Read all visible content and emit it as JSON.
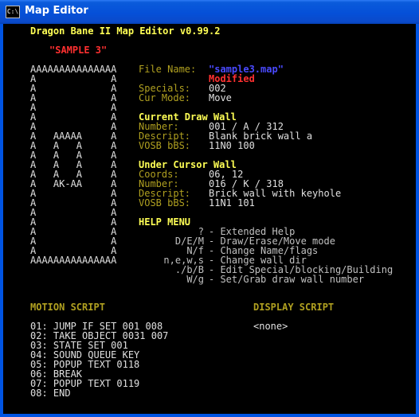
{
  "window": {
    "title": "Map Editor",
    "icon": "C:\\"
  },
  "header": {
    "app_title": "Dragon Bane II Map Editor v0.99.2",
    "map_title": "\"SAMPLE 3\""
  },
  "map_grid": [
    "AAAAAAAAAAAAAAA",
    "A             A",
    "A             A",
    "A             A",
    "A             A",
    "A             A",
    "A             A",
    "A   AAAAA     A",
    "A   A   A     A",
    "A   A   A     A",
    "A   A   A     A",
    "A   A   A     A",
    "A   AK-AA     A",
    "A             A",
    "A             A",
    "A             A",
    "A             A",
    "A             A",
    "A             A",
    "A             A",
    "AAAAAAAAAAAAAAA"
  ],
  "file_info": {
    "file_name_label": "File Name:",
    "file_name": "\"sample3.map\"",
    "modified": "Modified",
    "specials_label": "Specials:",
    "specials": "002",
    "cur_mode_label": "Cur Mode:",
    "cur_mode": "Move"
  },
  "current_draw_wall": {
    "heading": "Current Draw Wall",
    "number_label": "Number:",
    "number": "001 / A / 312",
    "descript_label": "Descript:",
    "descript": "Blank brick wall a",
    "vosb_label": "VOSB bBS:",
    "vosb": "11N0 100"
  },
  "under_cursor_wall": {
    "heading": "Under Cursor Wall",
    "coords_label": "Coords:",
    "coords": "06, 12",
    "number_label": "Number:",
    "number": "016 / K / 318",
    "descript_label": "Descript:",
    "descript": "Brick wall with keyhole",
    "vosb_label": "VOSB bBS:",
    "vosb": "11N1 101"
  },
  "help": {
    "heading": "HELP MENU",
    "items": [
      {
        "key": "?",
        "desc": "Extended Help"
      },
      {
        "key": "D/E/M",
        "desc": "Draw/Erase/Move mode"
      },
      {
        "key": "N/f",
        "desc": "Change Name/flags"
      },
      {
        "key": "n,e,w,s",
        "desc": "Change wall dir"
      },
      {
        "key": "./b/B",
        "desc": "Edit Special/blocking/Building"
      },
      {
        "key": "W/g",
        "desc": "Set/Grab draw wall number"
      }
    ]
  },
  "motion_script": {
    "heading": "MOTION SCRIPT",
    "lines": [
      "01: JUMP IF SET 001 008",
      "02: TAKE OBJECT 0031 007",
      "03: STATE SET 001",
      "04: SOUND QUEUE KEY",
      "05: POPUP TEXT 0118",
      "06: BREAK",
      "07: POPUP TEXT 0119",
      "08: END"
    ]
  },
  "display_script": {
    "heading": "DISPLAY SCRIPT",
    "lines": [
      "<none>"
    ]
  }
}
